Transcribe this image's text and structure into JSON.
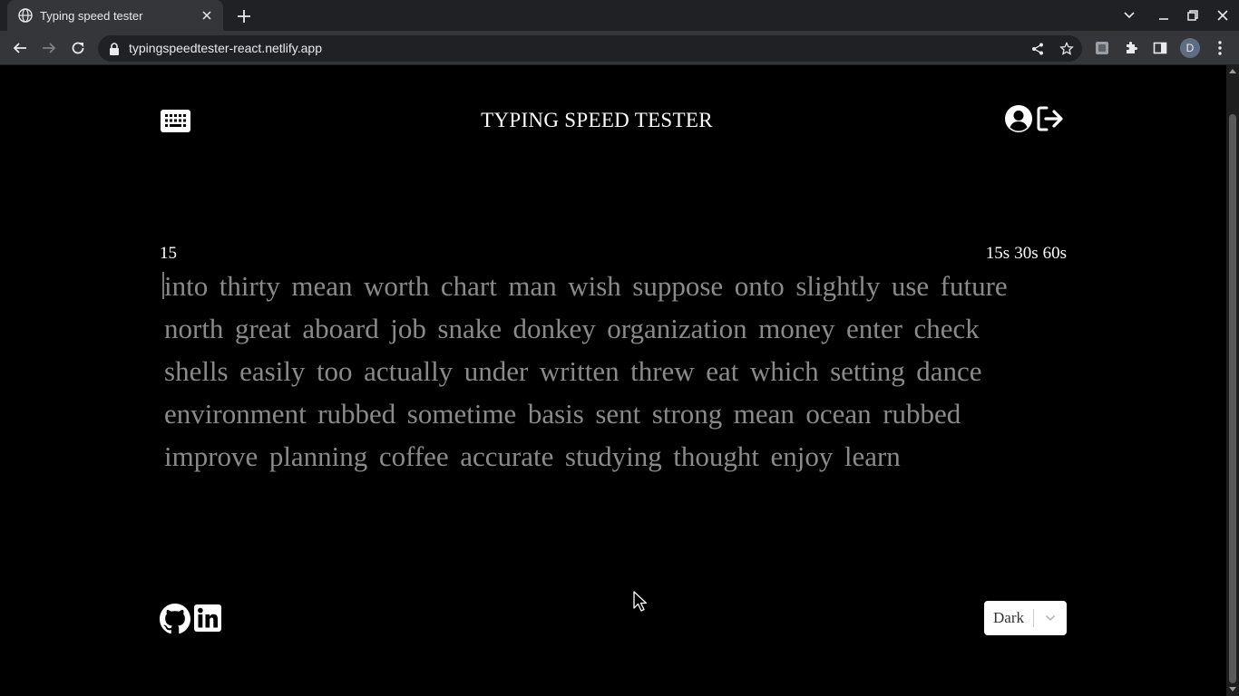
{
  "browser": {
    "tab_title": "Typing speed tester",
    "url": "typingspeedtester-react.netlify.app",
    "profile_initial": "D"
  },
  "header": {
    "title": "TYPING SPEED TESTER"
  },
  "test": {
    "counter": "15",
    "time_options": [
      "15s",
      "30s",
      "60s"
    ],
    "words": [
      "into",
      "thirty",
      "mean",
      "worth",
      "chart",
      "man",
      "wish",
      "suppose",
      "onto",
      "slightly",
      "use",
      "future",
      "north",
      "great",
      "aboard",
      "job",
      "snake",
      "donkey",
      "organization",
      "money",
      "enter",
      "check",
      "shells",
      "easily",
      "too",
      "actually",
      "under",
      "written",
      "threw",
      "eat",
      "which",
      "setting",
      "dance",
      "environment",
      "rubbed",
      "sometime",
      "basis",
      "sent",
      "strong",
      "mean",
      "ocean",
      "rubbed",
      "improve",
      "planning",
      "coffee",
      "accurate",
      "studying",
      "thought",
      "enjoy",
      "learn"
    ]
  },
  "footer": {
    "theme_selected": "Dark"
  },
  "colors": {
    "background": "#000000",
    "text": "#ffffff",
    "untyped_word": "#8a8a8a"
  }
}
